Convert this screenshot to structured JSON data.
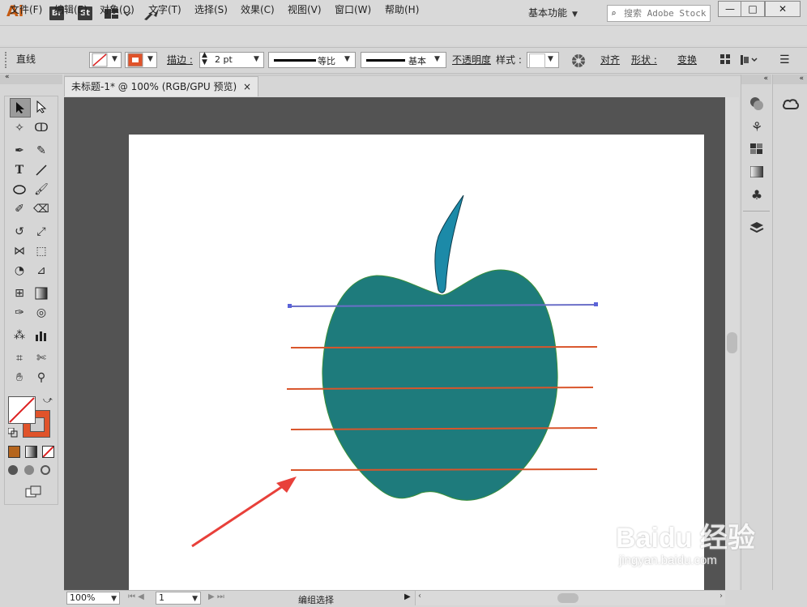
{
  "app": {
    "logo": "Ai",
    "badges": [
      "Br",
      "St"
    ],
    "workspace": "基本功能",
    "search_placeholder": "搜索 Adobe Stock"
  },
  "window_buttons": {
    "minimize": "—",
    "restore": "□",
    "close": "✕"
  },
  "menu": [
    "文件(F)",
    "编辑(E)",
    "对象(O)",
    "文字(T)",
    "选择(S)",
    "效果(C)",
    "视图(V)",
    "窗口(W)",
    "帮助(H)"
  ],
  "control": {
    "selection_type": "直线",
    "stroke_label": "描边 :",
    "stroke_value": "2 pt",
    "profile_label": "等比",
    "brush_label": "基本",
    "opacity_label": "不透明度",
    "style_label": "样式 :",
    "align_label": "对齐",
    "shape_label": "形状 :",
    "transform_label": "变换"
  },
  "document": {
    "tab_title": "未标题-1* @ 100% (RGB/GPU 预览)",
    "close": "×"
  },
  "status": {
    "zoom": "100%",
    "page": "1",
    "status_text": "编组选择"
  },
  "colors": {
    "apple": "#1e7b7c",
    "stem": "#1c8aa8",
    "guide_lines": "#d9552b",
    "selected_line": "#6b6fc8",
    "arrow": "#e8403a",
    "stroke_swatch": "#e0532a"
  },
  "watermark": {
    "brand": "Baidu",
    "cn": "经验",
    "url": "jingyan.baidu.com"
  }
}
